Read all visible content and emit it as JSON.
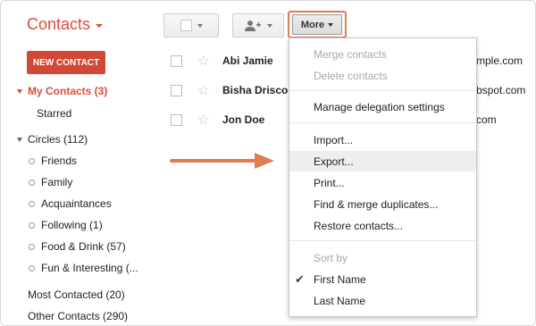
{
  "header": {
    "app_title": "Contacts"
  },
  "toolbar": {
    "more_label": "More"
  },
  "nav": {
    "new_contact": "NEW CONTACT",
    "my_contacts": "My Contacts (3)",
    "starred": "Starred",
    "circles": "Circles (112)",
    "circle_items": [
      "Friends",
      "Family",
      "Acquaintances",
      "Following (1)",
      "Food & Drink (57)",
      "Fun & Interesting (..."
    ],
    "most_contacted": "Most Contacted (20)",
    "other_contacts": "Other Contacts (290)"
  },
  "contacts": [
    {
      "name": "Abi Jamie",
      "email_tail": "mple.com"
    },
    {
      "name": "Bisha Driscoll",
      "email_tail": "bspot.com"
    },
    {
      "name": "Jon Doe",
      "email_tail": "com"
    }
  ],
  "menu": {
    "merge": "Merge contacts",
    "delete": "Delete contacts",
    "delegation": "Manage delegation settings",
    "import": "Import...",
    "export": "Export...",
    "print": "Print...",
    "find_merge": "Find & merge duplicates...",
    "restore": "Restore contacts...",
    "sort_by": "Sort by",
    "first_name": "First Name",
    "last_name": "Last Name"
  },
  "colors": {
    "brand": "#dd4b39",
    "new_contact_bg": "#d14836",
    "highlight_border": "#e07b53"
  }
}
